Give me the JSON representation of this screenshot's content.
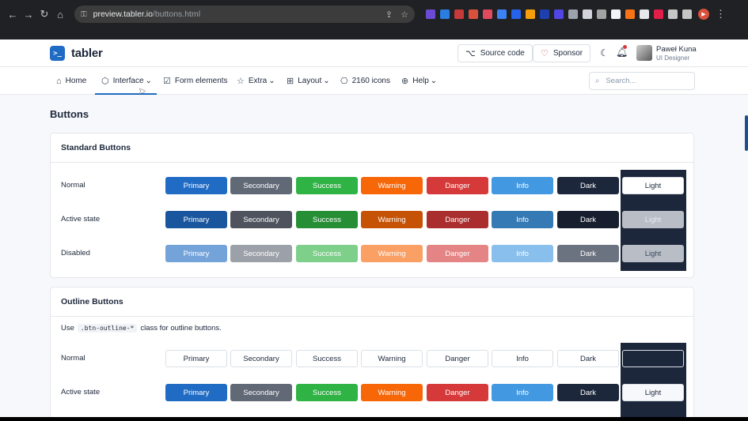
{
  "browser": {
    "url_host": "preview.tabler.io",
    "url_path": "/buttons.html"
  },
  "header": {
    "logo_text": "tabler",
    "logo_mark": ">_",
    "source_code": "Source code",
    "sponsor": "Sponsor",
    "user_name": "Paweł Kuna",
    "user_role": "UI Designer"
  },
  "nav": {
    "items": [
      {
        "label": "Home",
        "icon": "⌂"
      },
      {
        "label": "Interface",
        "icon": "⬡",
        "chevron": "⌄"
      },
      {
        "label": "Form elements",
        "icon": "☑"
      },
      {
        "label": "Extra",
        "icon": "☆",
        "chevron": "⌄"
      },
      {
        "label": "Layout",
        "icon": "⊞",
        "chevron": "⌄"
      },
      {
        "label": "2160 icons",
        "icon": "⎔"
      },
      {
        "label": "Help",
        "icon": "⊕",
        "chevron": "⌄"
      }
    ],
    "search_placeholder": "Search..."
  },
  "page_title": "Buttons",
  "standard": {
    "title": "Standard Buttons",
    "rows": [
      "Normal",
      "Active state",
      "Disabled"
    ]
  },
  "outline": {
    "title": "Outline Buttons",
    "note_prefix": "Use",
    "note_code": ".btn-outline-*",
    "note_suffix": "class for outline buttons.",
    "rows": [
      "Normal",
      "Active state"
    ]
  },
  "buttons": [
    "Primary",
    "Secondary",
    "Success",
    "Warning",
    "Danger",
    "Info",
    "Dark",
    "Light"
  ],
  "colors": {
    "primary": "#206bc4",
    "secondary": "#616876",
    "success": "#2fb344",
    "warning": "#f76707",
    "danger": "#d63939",
    "info": "#4299e1",
    "dark": "#1d273b",
    "light": "#f6f8fb"
  }
}
